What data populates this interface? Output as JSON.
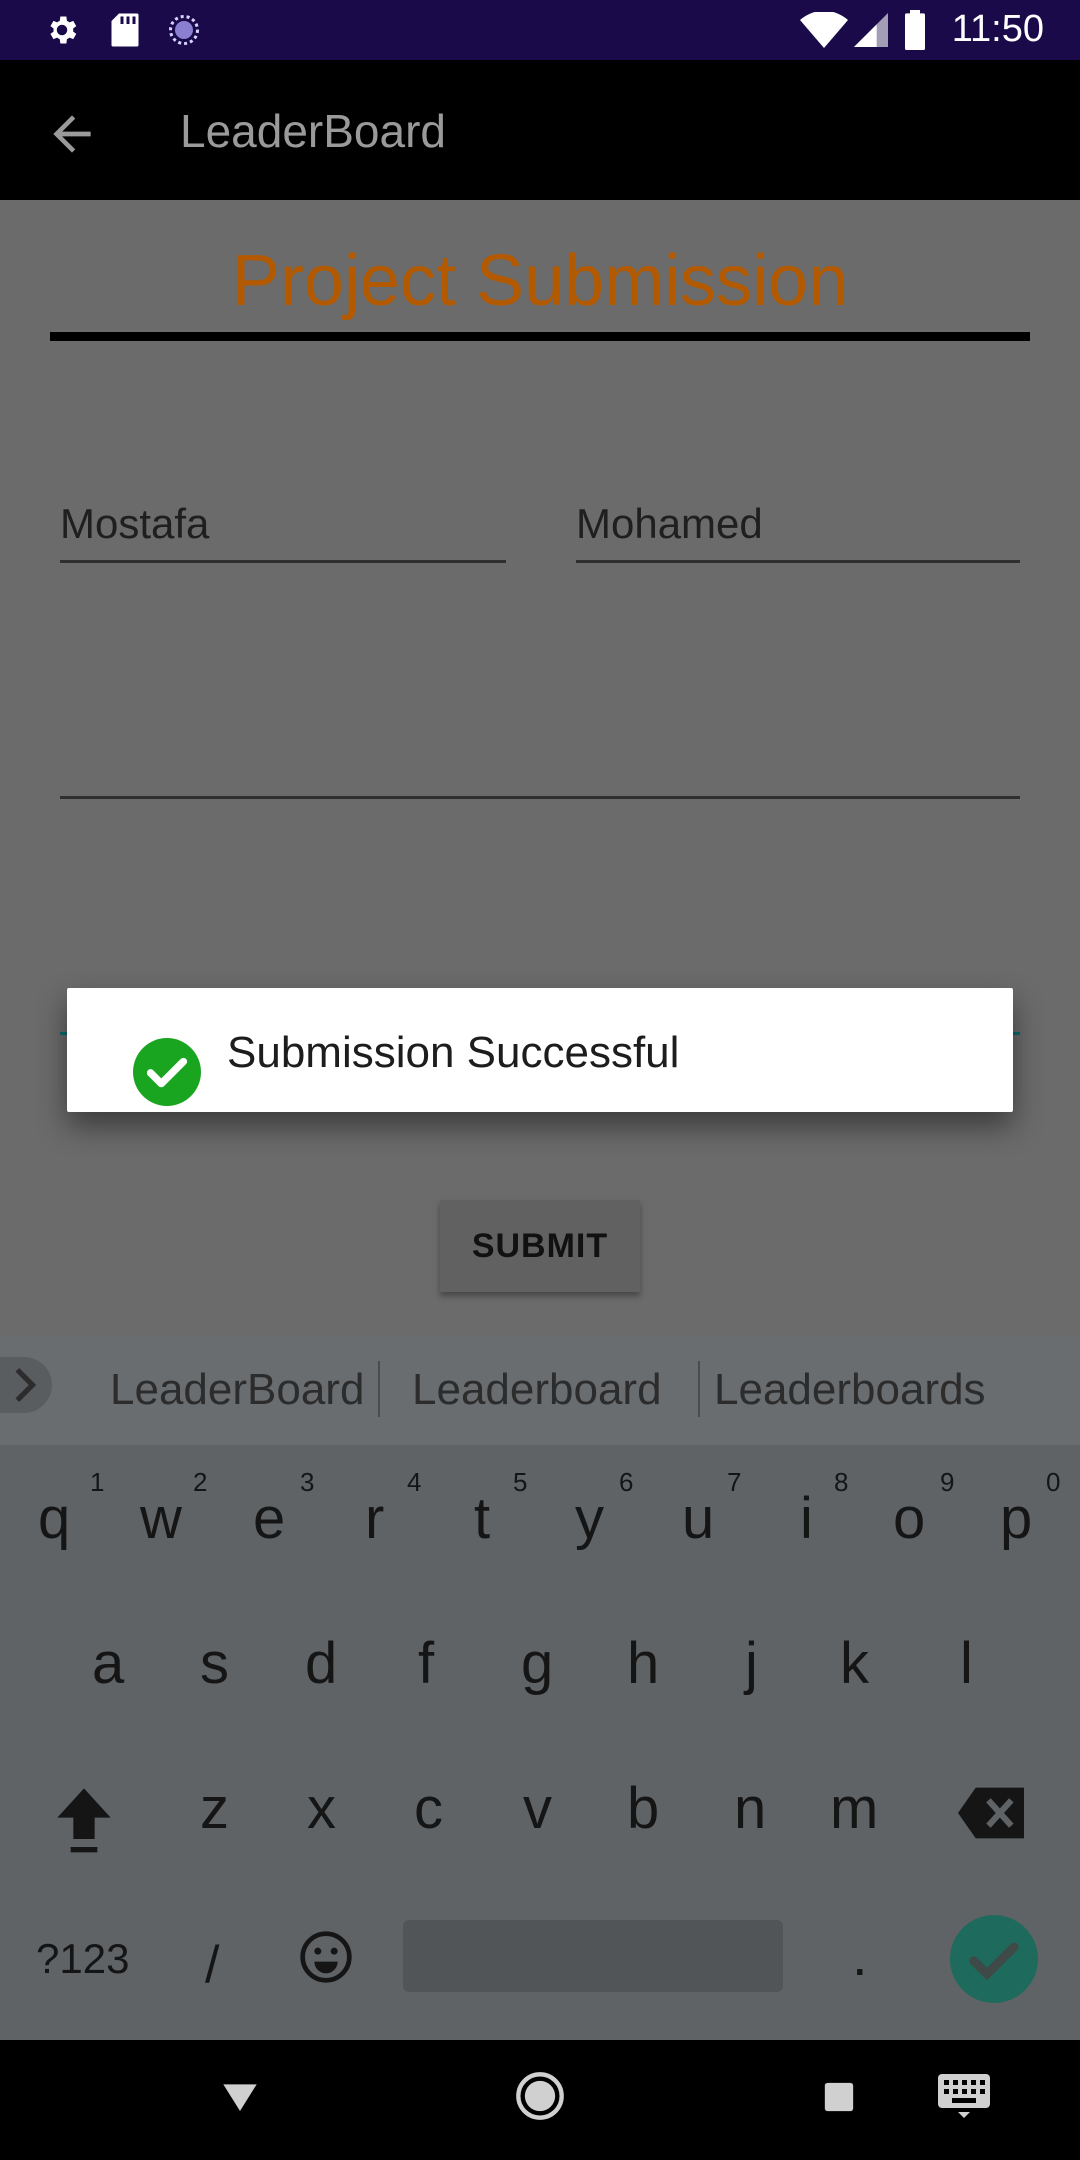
{
  "status_bar": {
    "time": "11:50",
    "left_icons": [
      "gear-icon",
      "sd-card-icon",
      "sync-icon"
    ],
    "right_icons": [
      "wifi-icon",
      "signal-icon",
      "battery-icon"
    ]
  },
  "app_bar": {
    "title": "LeaderBoard",
    "back_icon": "arrow-back-icon"
  },
  "form": {
    "title": "Project Submission",
    "first_name": "Mostafa",
    "last_name": "Mohamed",
    "email": "",
    "github_link": "",
    "submit_label": "SUBMIT"
  },
  "toast": {
    "message": "Submission Successful",
    "icon": "check-circle-icon",
    "icon_color": "#1aa521"
  },
  "keyboard": {
    "suggestions": [
      "LeaderBoard",
      "Leaderboard",
      "Leaderboards"
    ],
    "row1": [
      "q",
      "w",
      "e",
      "r",
      "t",
      "y",
      "u",
      "i",
      "o",
      "p"
    ],
    "row1_numbers": [
      "1",
      "2",
      "3",
      "4",
      "5",
      "6",
      "7",
      "8",
      "9",
      "0"
    ],
    "row2": [
      "a",
      "s",
      "d",
      "f",
      "g",
      "h",
      "j",
      "k",
      "l"
    ],
    "row3": [
      "z",
      "x",
      "c",
      "v",
      "b",
      "n",
      "m"
    ],
    "symbols_label": "?123",
    "slash_label": "/",
    "period_label": "."
  },
  "colors": {
    "title_color": "#b35a00",
    "status_bar": "#1a0a4a",
    "enter_key": "#1e6a5c"
  }
}
